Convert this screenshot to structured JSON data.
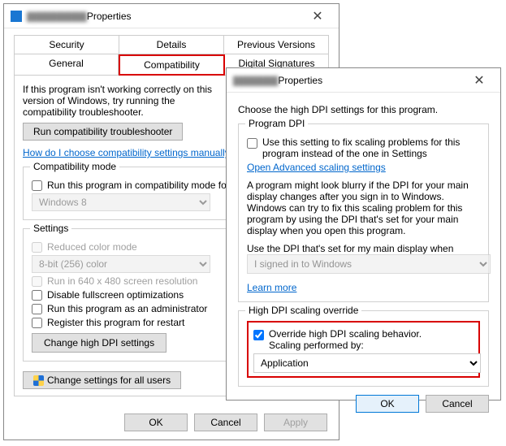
{
  "win1": {
    "title_suffix": "Properties",
    "tabs_row1": [
      "Security",
      "Details",
      "Previous Versions"
    ],
    "tabs_row2": [
      "General",
      "Compatibility",
      "Digital Signatures"
    ],
    "desc": "If this program isn't working correctly on this version of Windows, try running the compatibility troubleshooter.",
    "run_troubleshooter": "Run compatibility troubleshooter",
    "manual_link": "How do I choose compatibility settings manually?",
    "group_compat": "Compatibility mode",
    "ck_compat": "Run this program in compatibility mode for:",
    "compat_select": "Windows 8",
    "group_settings": "Settings",
    "ck_reduced": "Reduced color mode",
    "color_select": "8-bit (256) color",
    "ck_640": "Run in 640 x 480 screen resolution",
    "ck_disable_fs": "Disable fullscreen optimizations",
    "ck_admin": "Run this program as an administrator",
    "ck_register": "Register this program for restart",
    "btn_dpi": "Change high DPI settings",
    "btn_allusers": "Change settings for all users",
    "btn_ok": "OK",
    "btn_cancel": "Cancel",
    "btn_apply": "Apply"
  },
  "win2": {
    "title_suffix": "Properties",
    "intro": "Choose the high DPI settings for this program.",
    "group_prog": "Program DPI",
    "ck_use": "Use this setting to fix scaling problems for this program instead of the one in Settings",
    "adv_link": "Open Advanced scaling settings",
    "blurb": "A program might look blurry if the DPI for your main display changes after you sign in to Windows. Windows can try to fix this scaling problem for this program by using the DPI that's set for your main display when you open this program.",
    "use_label": "Use the DPI that's set for my main display when",
    "use_select": "I signed in to Windows",
    "learn_more": "Learn more",
    "group_override": "High DPI scaling override",
    "ck_override1": "Override high DPI scaling behavior.",
    "ck_override2": "Scaling performed by:",
    "override_select": "Application",
    "btn_ok": "OK",
    "btn_cancel": "Cancel"
  }
}
